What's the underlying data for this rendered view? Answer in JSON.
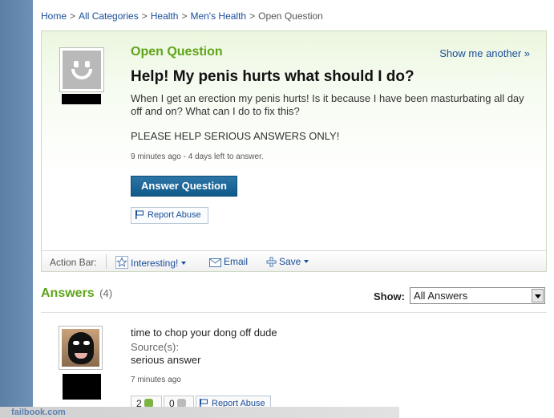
{
  "breadcrumb": {
    "items": [
      "Home",
      "All Categories",
      "Health",
      "Men's Health"
    ],
    "current": "Open Question",
    "separator": ">"
  },
  "question": {
    "label": "Open Question",
    "show_another": "Show me another »",
    "title": "Help! My penis hurts what should I do?",
    "body": "When I get an erection my penis hurts! Is it because I have been masturbating all day off and on? What can I do to fix this?",
    "emphasis": "PLEASE HELP SERIOUS ANSWERS ONLY!",
    "meta": "9 minutes ago - 4 days left to answer.",
    "answer_button": "Answer Question",
    "report_abuse": "Report Abuse"
  },
  "action_bar": {
    "label": "Action Bar:",
    "interesting": "Interesting!",
    "email": "Email",
    "save": "Save"
  },
  "answers": {
    "heading": "Answers",
    "count": "(4)",
    "show_label": "Show:",
    "show_selected": "All Answers",
    "items": [
      {
        "text": "time to chop your dong off dude",
        "source_label": "Source(s):",
        "source": "serious answer",
        "meta": "7 minutes ago",
        "thumbs_up": "2",
        "thumbs_down": "0",
        "report_abuse": "Report Abuse"
      }
    ]
  },
  "watermark": "failbook.com",
  "colors": {
    "accent_green": "#5fa51b",
    "link_blue": "#1a4d99",
    "button_blue": "#0f5a8b",
    "panel_green": "#ebf6de"
  }
}
